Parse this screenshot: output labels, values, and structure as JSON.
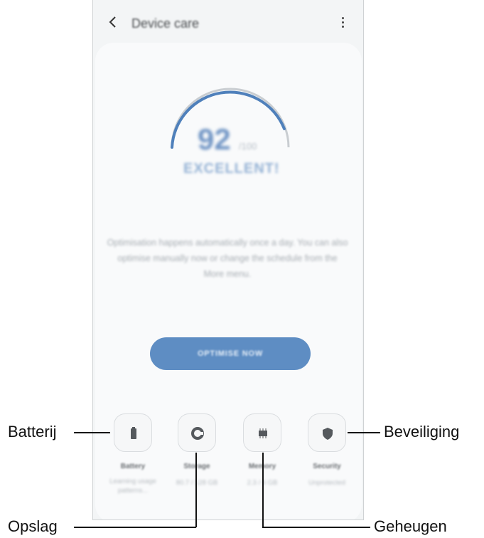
{
  "app": {
    "title": "Device care",
    "score": "92",
    "score_max": "/100",
    "status": "EXCELLENT!",
    "description": "Optimisation happens automatically once a day. You can also optimise manually now or change the schedule from the More menu.",
    "optimize_label": "OPTIMISE NOW",
    "gauge_fraction": 0.92
  },
  "tiles": [
    {
      "label": "Battery",
      "sub": "Learning usage patterns..."
    },
    {
      "label": "Storage",
      "sub": "80.7 / 128 GB"
    },
    {
      "label": "Memory",
      "sub": "2.3 / 6 GB"
    },
    {
      "label": "Security",
      "sub": "Unprotected"
    }
  ],
  "callouts": {
    "battery": "Batterij",
    "security": "Beveiliging",
    "storage": "Opslag",
    "memory": "Geheugen"
  },
  "colors": {
    "accent": "#5e8dc3",
    "gauge": "#4f80bb",
    "gauge_track": "#c9cdd1"
  }
}
